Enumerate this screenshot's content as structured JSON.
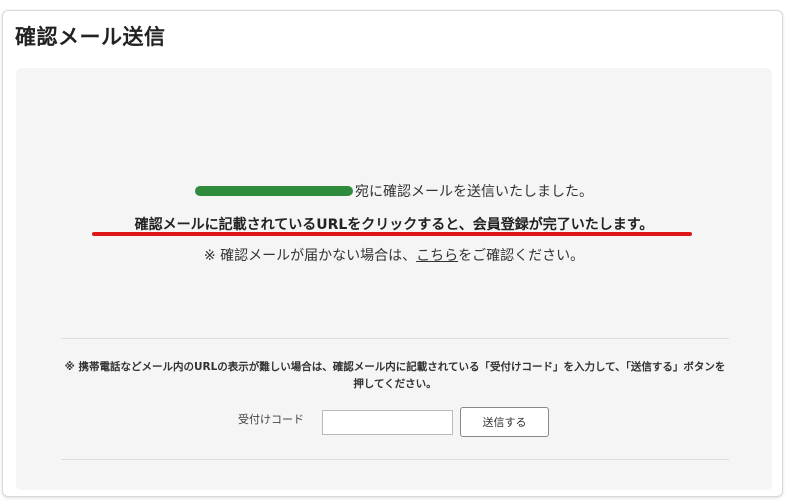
{
  "page": {
    "title": "確認メール送信"
  },
  "message": {
    "line1_suffix": "宛に確認メールを送信いたしました。",
    "line2": "確認メールに記載されているURLをクリックすると、会員登録が完了いたします。",
    "line3_prefix": "※ 確認メールが届かない場合は、",
    "line3_link": "こちら",
    "line3_suffix": "をご確認ください。"
  },
  "code_section": {
    "note": "※ 携帯電話などメール内のURLの表示が難しい場合は、確認メール内に記載されている「受付けコード」を入力して、「送信する」ボタンを押してください。",
    "code_label": "受付けコード",
    "code_value": "",
    "submit_label": "送信する"
  },
  "colors": {
    "accent_underline": "#e01515",
    "redaction": "#2e8b3c",
    "panel_background": "#f5f5f5"
  }
}
